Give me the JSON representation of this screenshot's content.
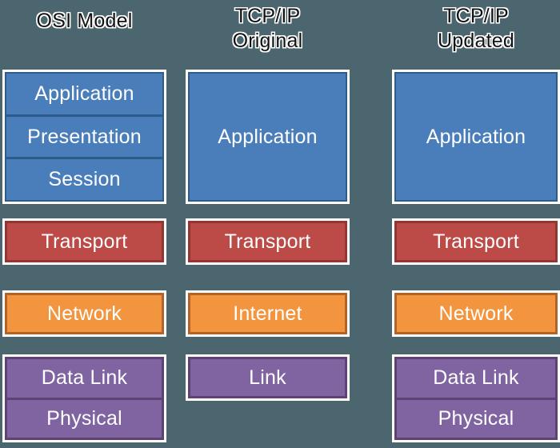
{
  "background_color": "#4c666f",
  "columns": [
    {
      "id": "osi",
      "title": "OSI Model",
      "title_line1": "OSI Model",
      "title_line2": "",
      "groups": [
        {
          "id": "osi-application-group",
          "color_name": "blue",
          "fill": "#4a7ebb",
          "border": "#2e5c8a",
          "layers": [
            "Application",
            "Presentation",
            "Session"
          ]
        },
        {
          "id": "osi-transport-group",
          "color_name": "red",
          "fill": "#bc4b48",
          "border": "#923634",
          "layers": [
            "Transport"
          ]
        },
        {
          "id": "osi-network-group",
          "color_name": "orange",
          "fill": "#f2953e",
          "border": "#b1632a",
          "layers": [
            "Network"
          ]
        },
        {
          "id": "osi-datalink-group",
          "color_name": "purple",
          "fill": "#8064a2",
          "border": "#5f4274",
          "layers": [
            "Data Link",
            "Physical"
          ]
        }
      ]
    },
    {
      "id": "tcpip-original",
      "title": "TCP/IP Original",
      "title_line1": "TCP/IP",
      "title_line2": "Original",
      "groups": [
        {
          "id": "orig-application-group",
          "color_name": "blue",
          "fill": "#4a7ebb",
          "border": "#2e5c8a",
          "layers": [
            "Application"
          ]
        },
        {
          "id": "orig-transport-group",
          "color_name": "red",
          "fill": "#bc4b48",
          "border": "#923634",
          "layers": [
            "Transport"
          ]
        },
        {
          "id": "orig-internet-group",
          "color_name": "orange",
          "fill": "#f2953e",
          "border": "#b1632a",
          "layers": [
            "Internet"
          ]
        },
        {
          "id": "orig-link-group",
          "color_name": "purple",
          "fill": "#8064a2",
          "border": "#5f4274",
          "layers": [
            "Link"
          ]
        }
      ]
    },
    {
      "id": "tcpip-updated",
      "title": "TCP/IP Updated",
      "title_line1": "TCP/IP",
      "title_line2": "Updated",
      "groups": [
        {
          "id": "upd-application-group",
          "color_name": "blue",
          "fill": "#4a7ebb",
          "border": "#2e5c8a",
          "layers": [
            "Application"
          ]
        },
        {
          "id": "upd-transport-group",
          "color_name": "red",
          "fill": "#bc4b48",
          "border": "#923634",
          "layers": [
            "Transport"
          ]
        },
        {
          "id": "upd-network-group",
          "color_name": "orange",
          "fill": "#f2953e",
          "border": "#b1632a",
          "layers": [
            "Network"
          ]
        },
        {
          "id": "upd-datalink-group",
          "color_name": "purple",
          "fill": "#8064a2",
          "border": "#5f4274",
          "layers": [
            "Data Link",
            "Physical"
          ]
        }
      ]
    }
  ]
}
